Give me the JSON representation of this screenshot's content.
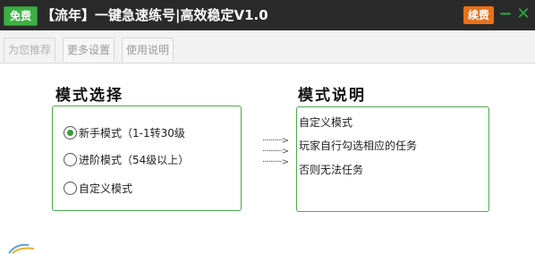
{
  "titlebar": {
    "badge": "免费",
    "title": "【流年】一键急速练号|高效稳定V1.0",
    "renew_label": "续费",
    "minimize_symbol": "−",
    "close_symbol": "✕"
  },
  "tabs": [
    {
      "label": "为您推荐",
      "active": true
    },
    {
      "label": "更多设置",
      "active": false
    },
    {
      "label": "使用说明",
      "active": false
    }
  ],
  "mode_select": {
    "title": "模式选择",
    "options": [
      {
        "label": "新手模式（1-1转30级",
        "checked": true
      },
      {
        "label": "进阶模式（54级以上）",
        "checked": false
      },
      {
        "label": "自定义模式",
        "checked": false
      }
    ]
  },
  "arrows": [
    "··········>",
    "··········>",
    "··········>"
  ],
  "mode_desc": {
    "title": "模式说明",
    "lines": [
      "自定义模式",
      "玩家自行勾选相应的任务",
      "否则无法任务"
    ]
  },
  "colors": {
    "titlebar_bg": "#2a2a2a",
    "free_badge": "#3cb043",
    "renew_button": "#e8701a",
    "window_controls": "#2fa845",
    "box_border": "#4fa84f"
  }
}
